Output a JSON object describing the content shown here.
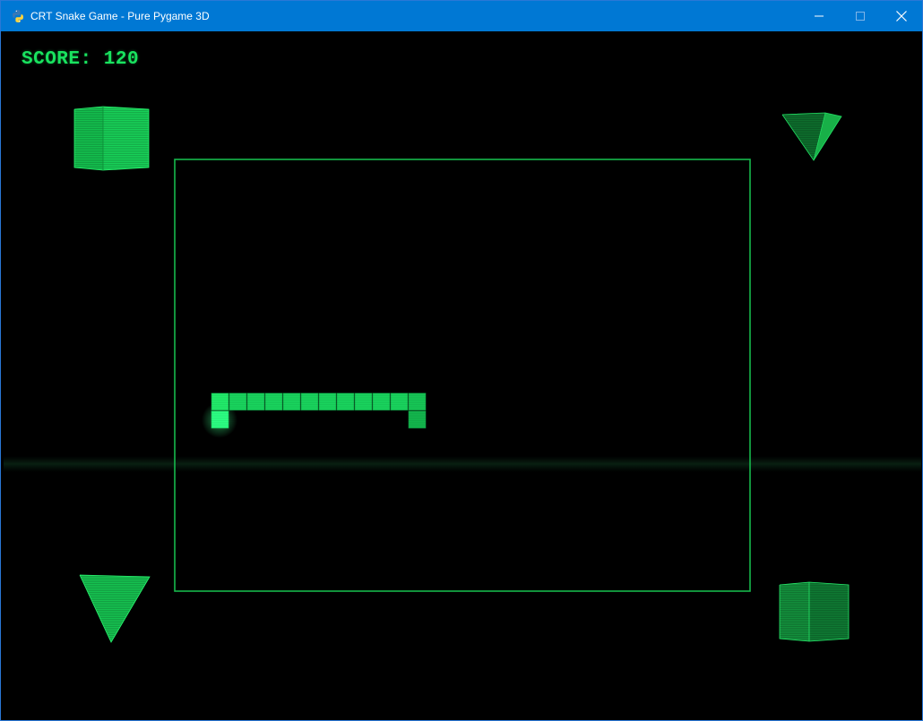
{
  "window": {
    "title": "CRT Snake Game - Pure Pygame 3D",
    "app_icon": "python-icon",
    "controls": [
      "minimize-icon",
      "maximize-icon",
      "close-icon"
    ],
    "accent_color": "#0078d4"
  },
  "hud": {
    "score_label": "SCORE:",
    "score_value": "120"
  },
  "game": {
    "background": "#000000",
    "primary_color": "#19e35f",
    "grid_cell_count": 12,
    "snake_length": 13,
    "decorations": [
      "cube",
      "pyramid",
      "pyramid",
      "cube"
    ]
  }
}
